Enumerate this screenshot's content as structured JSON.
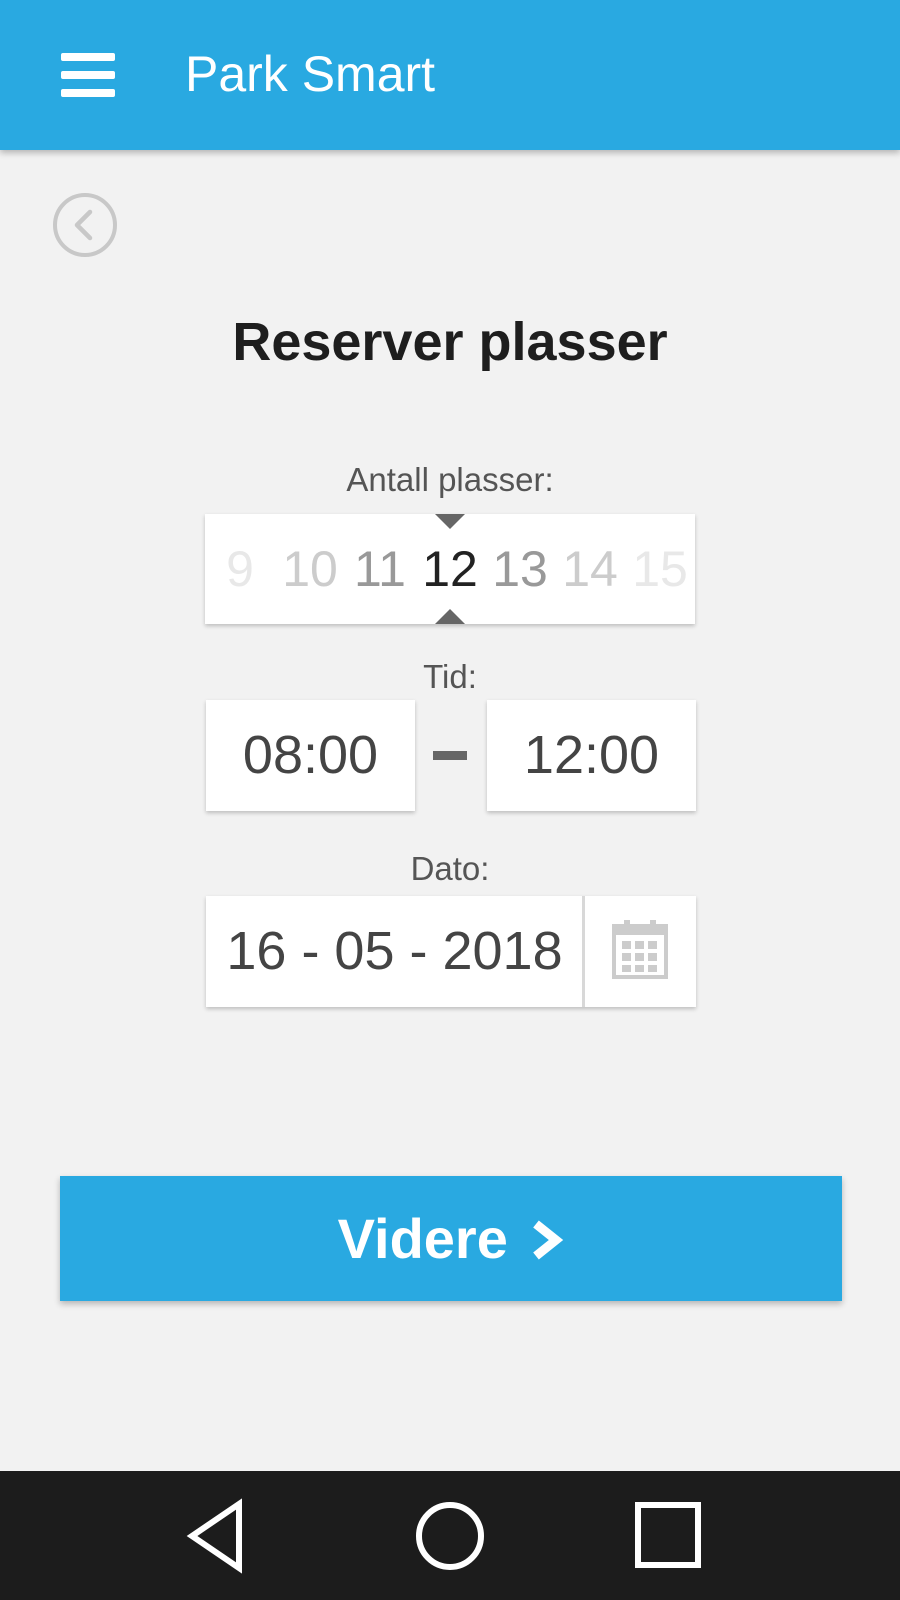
{
  "app_bar": {
    "title": "Park Smart",
    "menu_icon": "hamburger-menu-icon",
    "background": "#29a9e1"
  },
  "back_icon": "chevron-left-circle-icon",
  "page": {
    "title": "Reserver plasser"
  },
  "spaces": {
    "label": "Antall plasser:",
    "options": [
      "9",
      "10",
      "11",
      "12",
      "13",
      "14",
      "15"
    ],
    "selected": "12"
  },
  "time": {
    "label": "Tid:",
    "start": "08:00",
    "end": "12:00"
  },
  "date": {
    "label": "Dato:",
    "value": "16 - 05 - 2018",
    "calendar_icon": "calendar-icon"
  },
  "continue_button": {
    "label": "Videre",
    "icon": "chevron-right-icon",
    "background": "#29a9e1"
  },
  "system_nav": {
    "back_icon": "triangle-back-icon",
    "home_icon": "circle-home-icon",
    "recent_icon": "square-recents-icon"
  }
}
